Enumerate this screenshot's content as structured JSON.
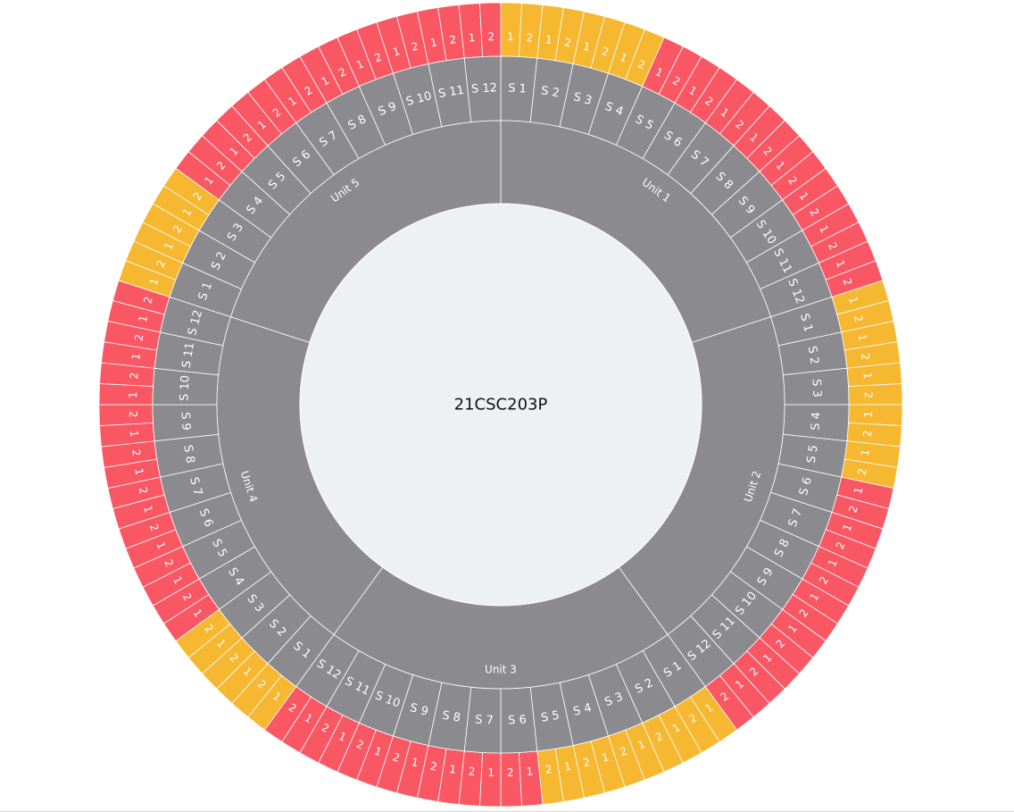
{
  "center_label": "21CSC203P",
  "colors": {
    "unit": "#8b8a8f",
    "session": "#8b8a8f",
    "part_red": "#f95763",
    "part_yellow": "#f6b731",
    "center_fill": "#eef1f4"
  },
  "parts_per_session": [
    "1",
    "2"
  ],
  "units": [
    {
      "label": "Unit 1",
      "sessions": [
        {
          "label": "S 1",
          "status": "yellow"
        },
        {
          "label": "S 2",
          "status": "yellow"
        },
        {
          "label": "S 3",
          "status": "yellow"
        },
        {
          "label": "S 4",
          "status": "yellow"
        },
        {
          "label": "S 5",
          "status": "red"
        },
        {
          "label": "S 6",
          "status": "red"
        },
        {
          "label": "S 7",
          "status": "red"
        },
        {
          "label": "S 8",
          "status": "red"
        },
        {
          "label": "S 9",
          "status": "red"
        },
        {
          "label": "S 10",
          "status": "red"
        },
        {
          "label": "S 11",
          "status": "red"
        },
        {
          "label": "S 12",
          "status": "red"
        }
      ]
    },
    {
      "label": "Unit 2",
      "sessions": [
        {
          "label": "S 1",
          "status": "yellow"
        },
        {
          "label": "S 2",
          "status": "yellow"
        },
        {
          "label": "S 3",
          "status": "yellow"
        },
        {
          "label": "S 4",
          "status": "yellow"
        },
        {
          "label": "S 5",
          "status": "yellow"
        },
        {
          "label": "S 6",
          "status": "red"
        },
        {
          "label": "S 7",
          "status": "red"
        },
        {
          "label": "S 8",
          "status": "red"
        },
        {
          "label": "S 9",
          "status": "red"
        },
        {
          "label": "S 10",
          "status": "red"
        },
        {
          "label": "S 11",
          "status": "red"
        },
        {
          "label": "S 12",
          "status": "red"
        }
      ]
    },
    {
      "label": "Unit 3",
      "sessions": [
        {
          "label": "S 1",
          "status": "yellow"
        },
        {
          "label": "S 2",
          "status": "yellow"
        },
        {
          "label": "S 3",
          "status": "yellow"
        },
        {
          "label": "S 4",
          "status": "yellow"
        },
        {
          "label": "S 5",
          "status": "yellow"
        },
        {
          "label": "S 6",
          "status": "red"
        },
        {
          "label": "S 7",
          "status": "red"
        },
        {
          "label": "S 8",
          "status": "red"
        },
        {
          "label": "S 9",
          "status": "red"
        },
        {
          "label": "S 10",
          "status": "red"
        },
        {
          "label": "S 11",
          "status": "red"
        },
        {
          "label": "S 12",
          "status": "red"
        }
      ]
    },
    {
      "label": "Unit 4",
      "sessions": [
        {
          "label": "S 1",
          "status": "yellow"
        },
        {
          "label": "S 2",
          "status": "yellow"
        },
        {
          "label": "S 3",
          "status": "yellow"
        },
        {
          "label": "S 4",
          "status": "red"
        },
        {
          "label": "S 5",
          "status": "red"
        },
        {
          "label": "S 6",
          "status": "red"
        },
        {
          "label": "S 7",
          "status": "red"
        },
        {
          "label": "S 8",
          "status": "red"
        },
        {
          "label": "S 9",
          "status": "red"
        },
        {
          "label": "S 10",
          "status": "red"
        },
        {
          "label": "S 11",
          "status": "red"
        },
        {
          "label": "S 12",
          "status": "red"
        }
      ]
    },
    {
      "label": "Unit 5",
      "sessions": [
        {
          "label": "S 1",
          "status": "yellow"
        },
        {
          "label": "S 2",
          "status": "yellow"
        },
        {
          "label": "S 3",
          "status": "yellow"
        },
        {
          "label": "S 4",
          "status": "red"
        },
        {
          "label": "S 5",
          "status": "red"
        },
        {
          "label": "S 6",
          "status": "red"
        },
        {
          "label": "S 7",
          "status": "red"
        },
        {
          "label": "S 8",
          "status": "red"
        },
        {
          "label": "S 9",
          "status": "red"
        },
        {
          "label": "S 10",
          "status": "red"
        },
        {
          "label": "S 11",
          "status": "red"
        },
        {
          "label": "S 12",
          "status": "red"
        }
      ]
    }
  ]
}
